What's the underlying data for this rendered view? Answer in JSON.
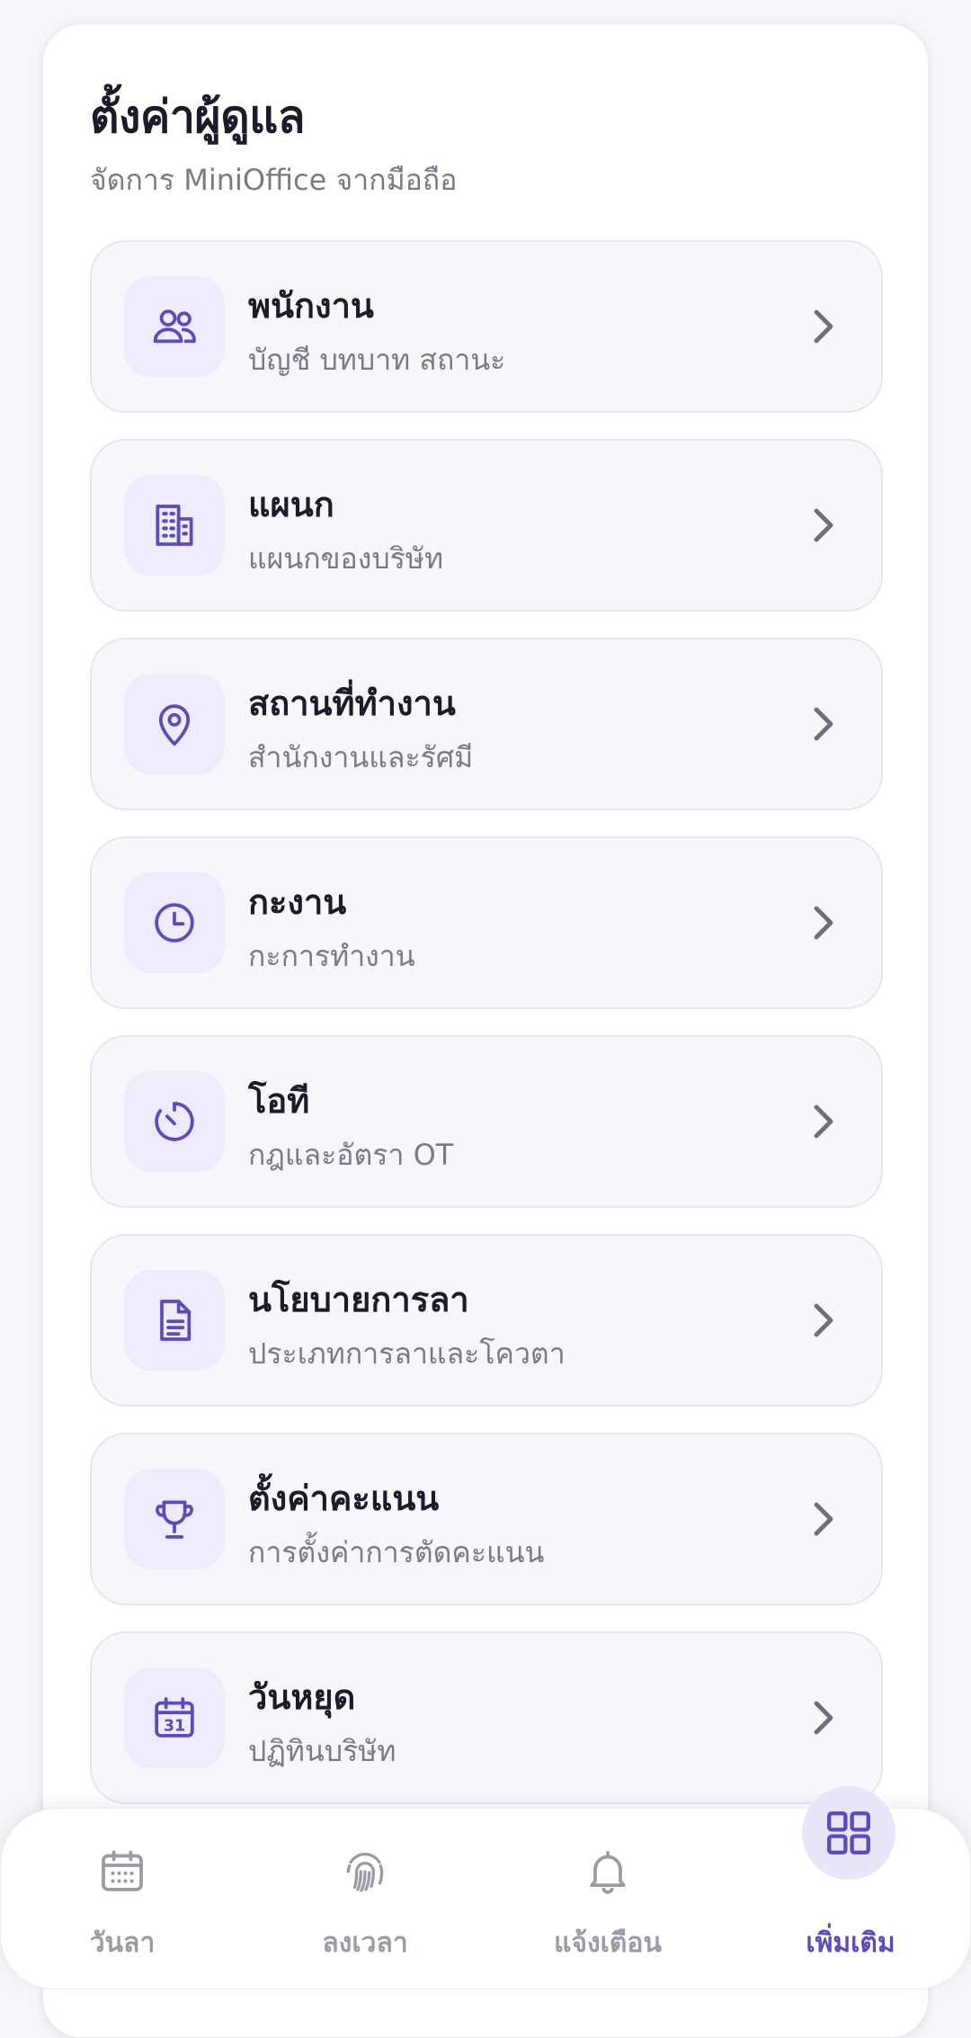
{
  "header": {
    "title": "ตั้งค่าผู้ดูแล",
    "subtitle": "จัดการ MiniOffice จากมือถือ"
  },
  "menu": [
    {
      "title": "พนักงาน",
      "description": "บัญชี บทบาท สถานะ",
      "icon": "users-icon"
    },
    {
      "title": "แผนก",
      "description": "แผนกของบริษัท",
      "icon": "building-icon"
    },
    {
      "title": "สถานที่ทำงาน",
      "description": "สำนักงานและรัศมี",
      "icon": "map-pin-icon"
    },
    {
      "title": "กะงาน",
      "description": "กะการทำงาน",
      "icon": "clock-icon"
    },
    {
      "title": "โอที",
      "description": "กฎและอัตรา OT",
      "icon": "timer-icon"
    },
    {
      "title": "นโยบายการลา",
      "description": "ประเภทการลาและโควตา",
      "icon": "document-icon"
    },
    {
      "title": "ตั้งค่าคะแนน",
      "description": "การตั้งค่าการตัดคะแนน",
      "icon": "trophy-icon"
    },
    {
      "title": "วันหยุด",
      "description": "ปฏิทินบริษัท",
      "icon": "calendar-icon"
    }
  ],
  "calendar_icon_day": "31",
  "bottom_nav": [
    {
      "label": "วันลา",
      "icon": "calendar-grid-icon",
      "active": false
    },
    {
      "label": "ลงเวลา",
      "icon": "fingerprint-icon",
      "active": false
    },
    {
      "label": "แจ้งเตือน",
      "icon": "bell-icon",
      "active": false
    },
    {
      "label": "เพิ่มเติม",
      "icon": "grid-icon",
      "active": true
    }
  ],
  "colors": {
    "accent": "#5a4bc0",
    "icon_tile": "#eeecfc",
    "card_bg": "#f7f6fb",
    "inactive_nav": "#9b9aa6"
  }
}
